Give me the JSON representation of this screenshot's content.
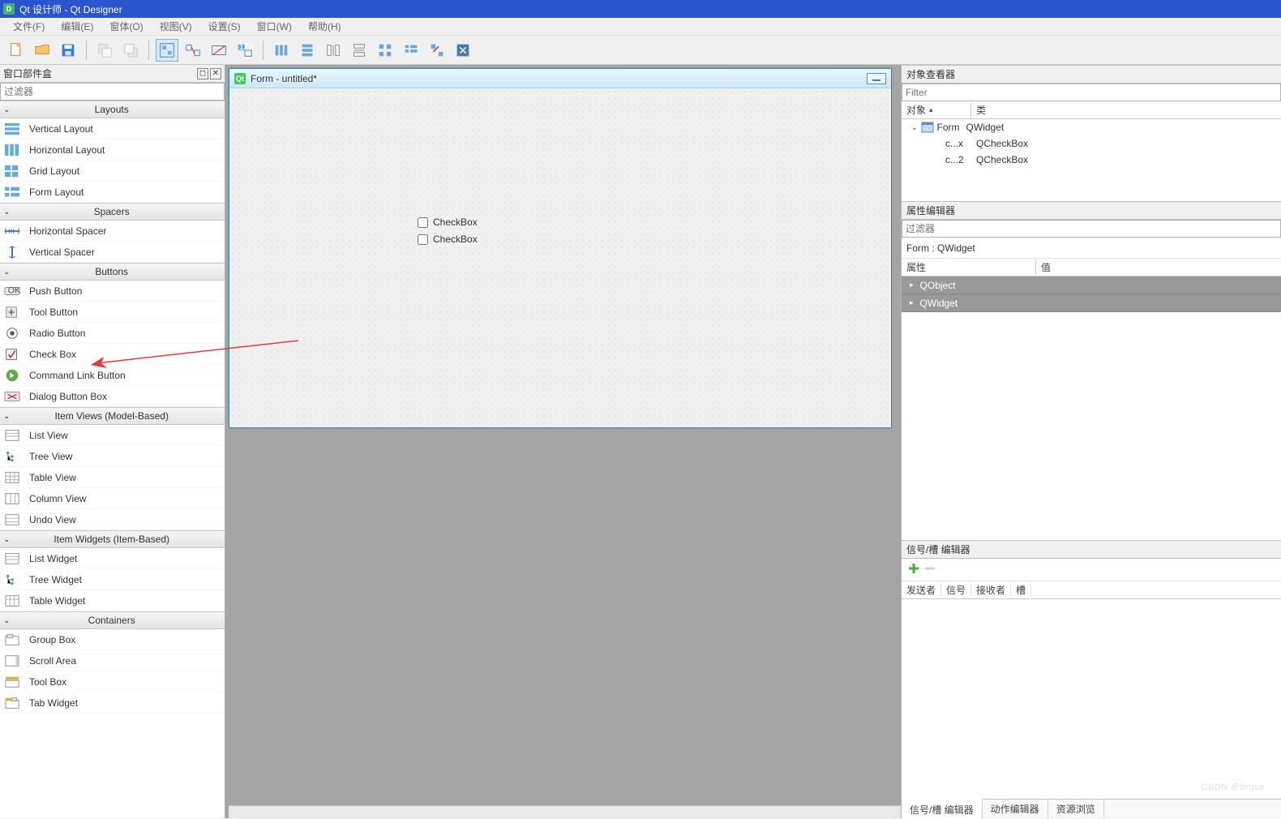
{
  "titlebar": {
    "text": "Qt 设计师 - Qt Designer"
  },
  "menu": {
    "file": "文件(F)",
    "edit": "编辑(E)",
    "form": "窗体(O)",
    "view": "视图(V)",
    "settings": "设置(S)",
    "window": "窗口(W)",
    "help": "帮助(H)"
  },
  "widgetbox": {
    "title": "窗口部件盒",
    "filter_placeholder": "过滤器",
    "categories": {
      "layouts": {
        "label": "Layouts",
        "items": [
          "Vertical Layout",
          "Horizontal Layout",
          "Grid Layout",
          "Form Layout"
        ]
      },
      "spacers": {
        "label": "Spacers",
        "items": [
          "Horizontal Spacer",
          "Vertical Spacer"
        ]
      },
      "buttons": {
        "label": "Buttons",
        "items": [
          "Push Button",
          "Tool Button",
          "Radio Button",
          "Check Box",
          "Command Link Button",
          "Dialog Button Box"
        ]
      },
      "item_views": {
        "label": "Item Views (Model-Based)",
        "items": [
          "List View",
          "Tree View",
          "Table View",
          "Column View",
          "Undo View"
        ]
      },
      "item_widgets": {
        "label": "Item Widgets (Item-Based)",
        "items": [
          "List Widget",
          "Tree Widget",
          "Table Widget"
        ]
      },
      "containers": {
        "label": "Containers",
        "items": [
          "Group Box",
          "Scroll Area",
          "Tool Box",
          "Tab Widget"
        ]
      }
    }
  },
  "form": {
    "title": "Form - untitled*",
    "checkbox1": "CheckBox",
    "checkbox2": "CheckBox"
  },
  "inspector": {
    "title": "对象查看器",
    "filter_placeholder": "Filter",
    "col_object": "对象",
    "col_class": "类",
    "rows": [
      {
        "name": "Form",
        "klass": "QWidget",
        "level": 0,
        "expandable": true
      },
      {
        "name": "c...x",
        "klass": "QCheckBox",
        "level": 1,
        "expandable": false
      },
      {
        "name": "c...2",
        "klass": "QCheckBox",
        "level": 1,
        "expandable": false
      }
    ]
  },
  "props": {
    "title": "属性编辑器",
    "filter_placeholder": "过滤器",
    "context": "Form : QWidget",
    "col_prop": "属性",
    "col_value": "值",
    "groups": [
      "QObject",
      "QWidget"
    ]
  },
  "sig": {
    "title": "信号/槽 编辑器",
    "cols": {
      "sender": "发送者",
      "signal": "信号",
      "receiver": "接收者",
      "slot": "槽"
    }
  },
  "tabs": {
    "sigslot": "信号/槽 编辑器",
    "actions": "动作编辑器",
    "resources": "资源浏览"
  },
  "watermark": "CSDN @bruce"
}
